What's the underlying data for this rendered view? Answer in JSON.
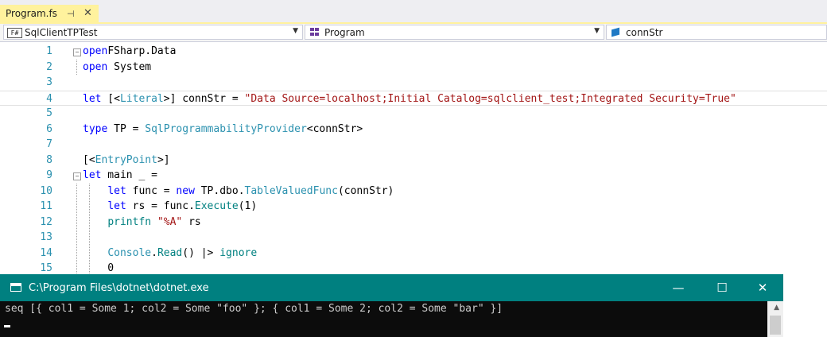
{
  "tab": {
    "title": "Program.fs",
    "pin": "⊣",
    "close": "✕"
  },
  "navbar": {
    "project": "SqlClientTPTest",
    "module": "Program",
    "member": "connStr",
    "fs_badge": "F#"
  },
  "editor": {
    "lines": [
      {
        "n": "1",
        "tokens": [
          [
            "kw",
            "open"
          ],
          [
            "",
            "FSharp.Data"
          ]
        ]
      },
      {
        "n": "2",
        "tokens": [
          [
            "kw",
            "open"
          ],
          [
            "",
            " System"
          ]
        ]
      },
      {
        "n": "3",
        "tokens": []
      },
      {
        "n": "4",
        "tokens": [
          [
            "kw",
            "let"
          ],
          [
            "",
            " [<"
          ],
          [
            "ty",
            "Literal"
          ],
          [
            "",
            ">] connStr = "
          ],
          [
            "st",
            "\"Data Source=localhost;Initial Catalog=sqlclient_test;Integrated Security=True\""
          ]
        ]
      },
      {
        "n": "5",
        "tokens": []
      },
      {
        "n": "6",
        "tokens": [
          [
            "kw",
            "type"
          ],
          [
            "",
            " TP = "
          ],
          [
            "ty",
            "SqlProgrammabilityProvider"
          ],
          [
            "",
            "<connStr>"
          ]
        ]
      },
      {
        "n": "7",
        "tokens": []
      },
      {
        "n": "8",
        "tokens": [
          [
            "",
            "[<"
          ],
          [
            "ty",
            "EntryPoint"
          ],
          [
            "",
            ">]"
          ]
        ]
      },
      {
        "n": "9",
        "tokens": [
          [
            "kw",
            "let"
          ],
          [
            "",
            " main _ ="
          ]
        ]
      },
      {
        "n": "10",
        "tokens": [
          [
            "",
            "    "
          ],
          [
            "kw",
            "let"
          ],
          [
            "",
            " func = "
          ],
          [
            "kw",
            "new"
          ],
          [
            "",
            " TP.dbo."
          ],
          [
            "ty",
            "TableValuedFunc"
          ],
          [
            "",
            "(connStr)"
          ]
        ]
      },
      {
        "n": "11",
        "tokens": [
          [
            "",
            "    "
          ],
          [
            "kw",
            "let"
          ],
          [
            "",
            " rs = func."
          ],
          [
            "fn",
            "Execute"
          ],
          [
            "",
            "(1)"
          ]
        ]
      },
      {
        "n": "12",
        "tokens": [
          [
            "",
            "    "
          ],
          [
            "fn",
            "printfn"
          ],
          [
            "",
            " "
          ],
          [
            "st",
            "\"%A\""
          ],
          [
            "",
            " rs"
          ]
        ]
      },
      {
        "n": "13",
        "tokens": []
      },
      {
        "n": "14",
        "tokens": [
          [
            "",
            "    "
          ],
          [
            "ty",
            "Console"
          ],
          [
            "",
            "."
          ],
          [
            "fn",
            "Read"
          ],
          [
            "",
            "() |> "
          ],
          [
            "fn",
            "ignore"
          ]
        ]
      },
      {
        "n": "15",
        "tokens": [
          [
            "",
            "    0"
          ]
        ]
      }
    ]
  },
  "console": {
    "title": "C:\\Program Files\\dotnet\\dotnet.exe",
    "output": "seq [{ col1 = Some 1; col2 = Some \"foo\" }; { col1 = Some 2; col2 = Some \"bar\" }]",
    "minimize": "—",
    "maximize": "☐",
    "close": "✕"
  }
}
